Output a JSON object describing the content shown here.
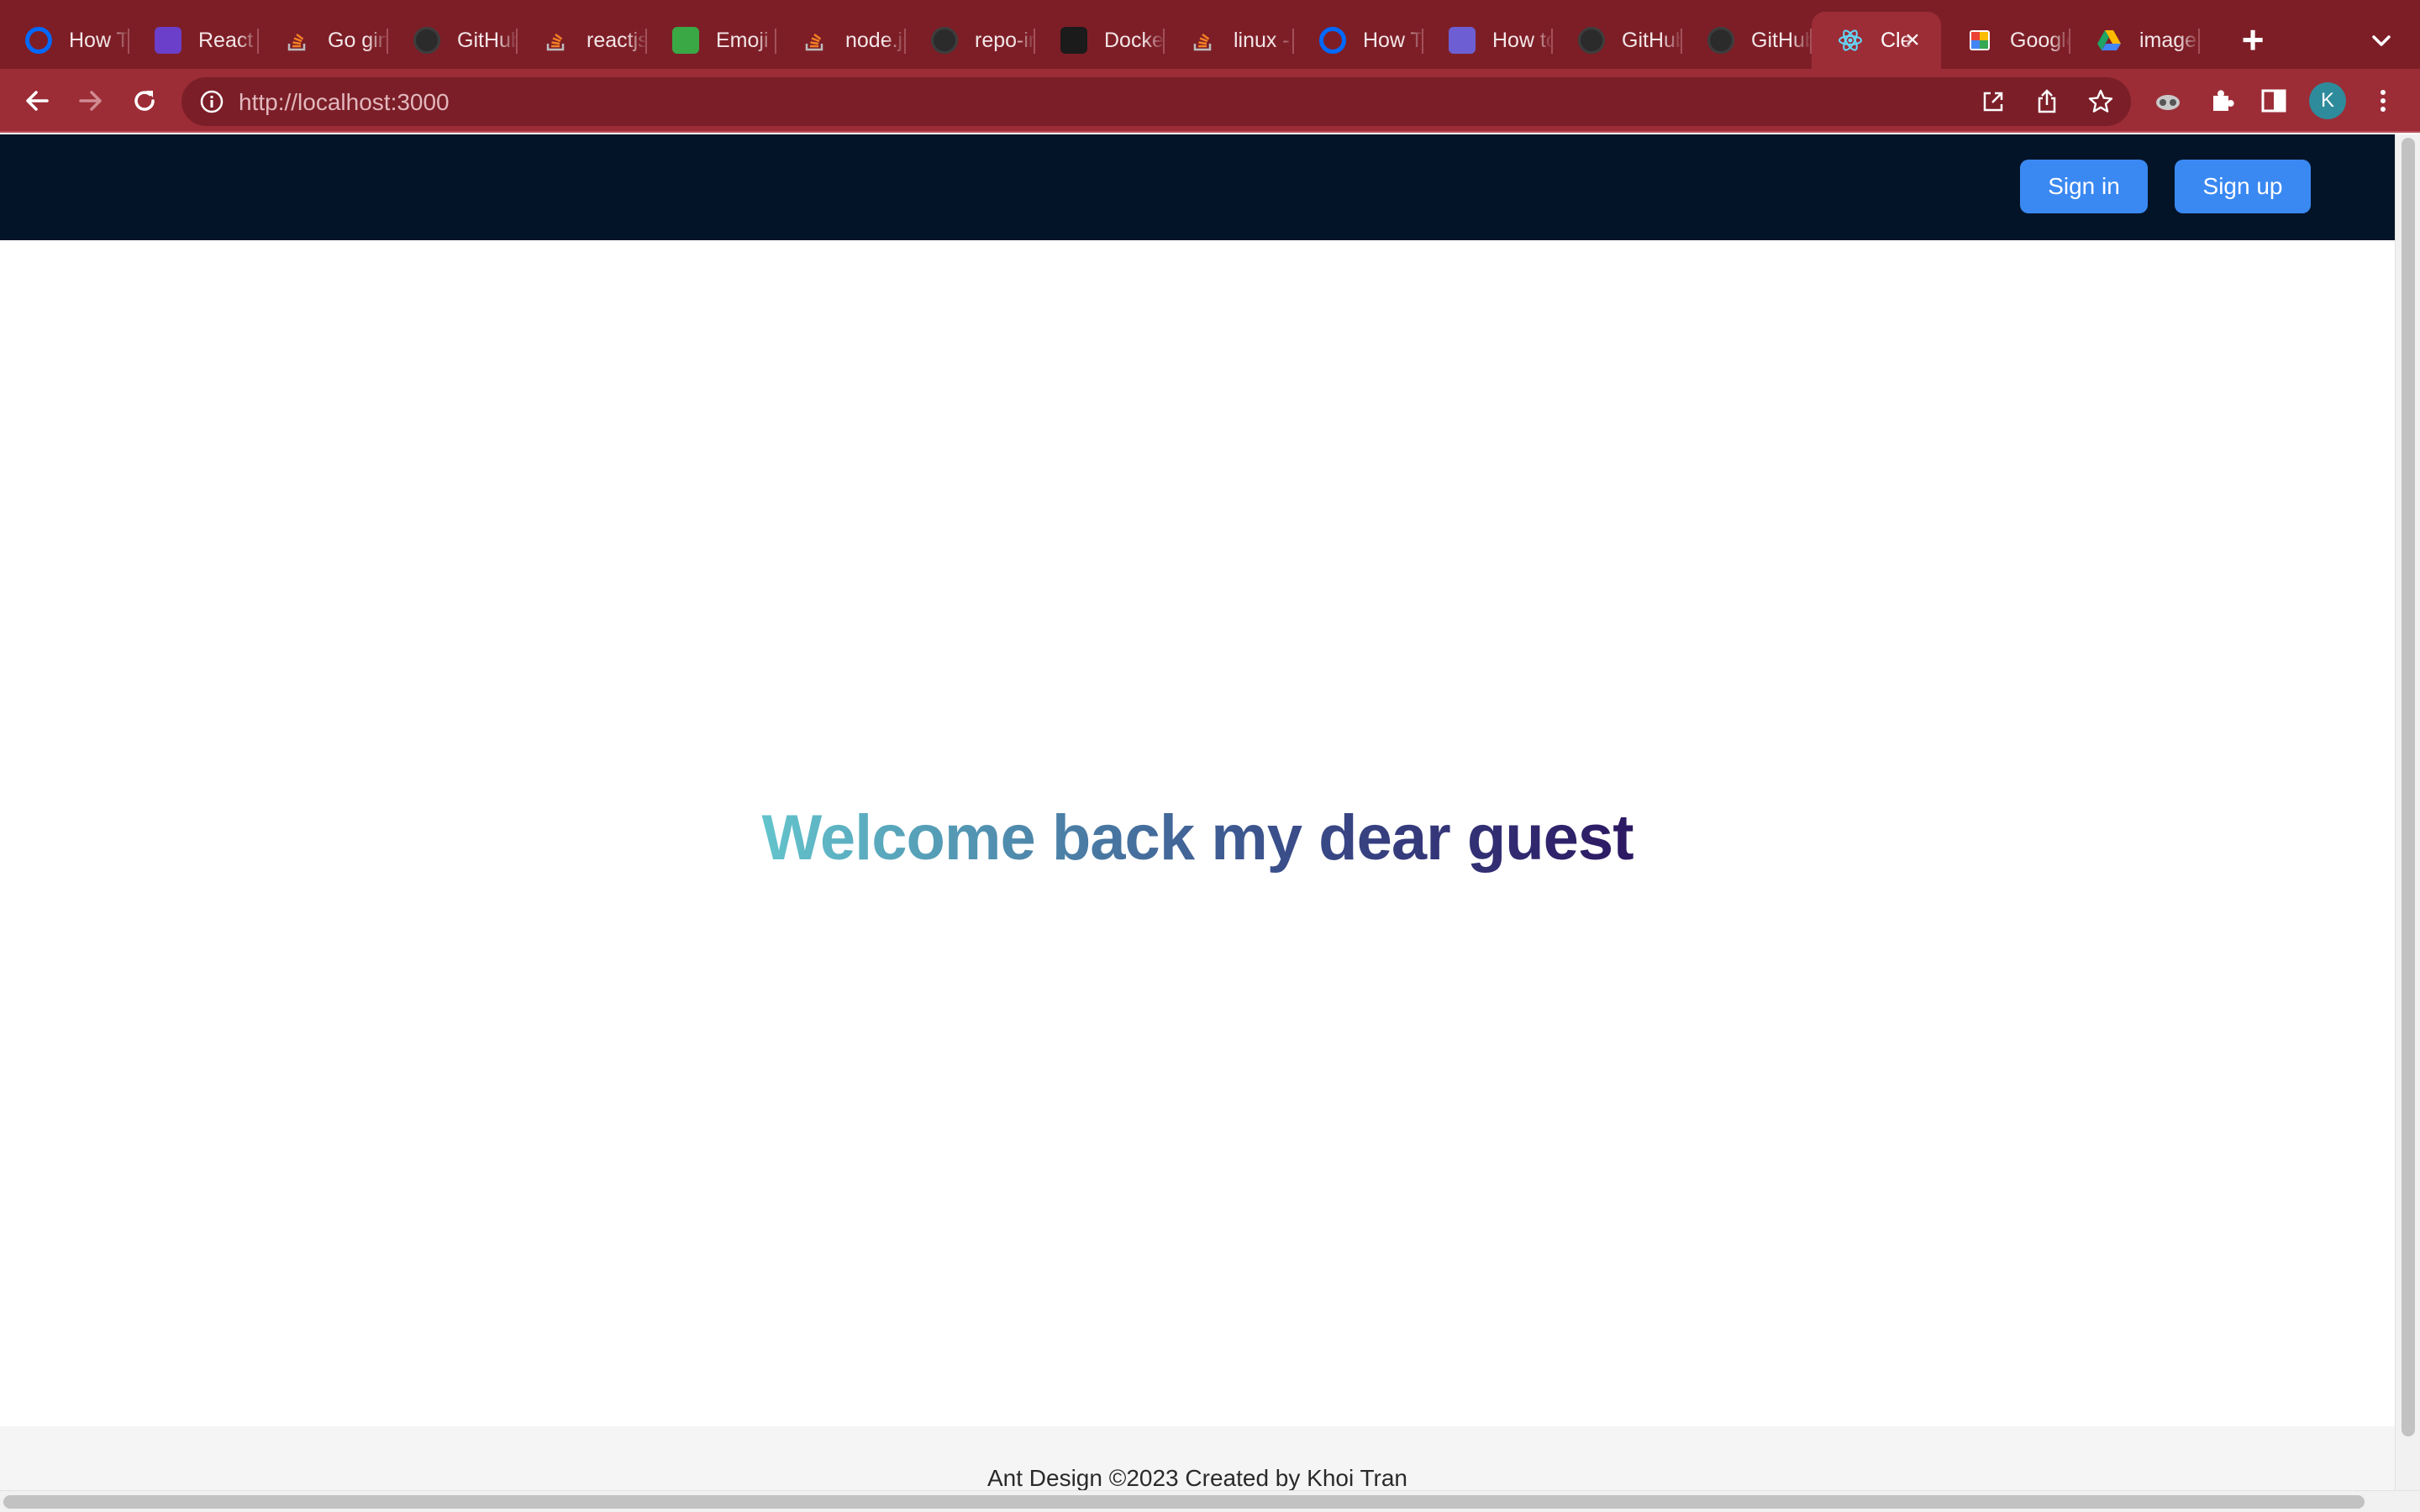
{
  "browser": {
    "tabs": [
      {
        "title": "How To",
        "favicon": "digitalocean-icon",
        "color": "#0069ff"
      },
      {
        "title": "React",
        "favicon": "rocket-app-icon",
        "color": "#6b3fc9"
      },
      {
        "title": "Go gin",
        "favicon": "stackoverflow-icon",
        "color": "#f48024"
      },
      {
        "title": "GitHub",
        "favicon": "github-icon",
        "color": "#24292f"
      },
      {
        "title": "reactjs",
        "favicon": "stackoverflow-icon",
        "color": "#f48024"
      },
      {
        "title": "Emoji",
        "favicon": "emoji-app-icon",
        "color": "#3aa845"
      },
      {
        "title": "node.js",
        "favicon": "stackoverflow-icon",
        "color": "#f48024"
      },
      {
        "title": "repo-in",
        "favicon": "github-icon",
        "color": "#24292f"
      },
      {
        "title": "Docker",
        "favicon": "docker-doc-icon",
        "color": "#1b1b1b"
      },
      {
        "title": "linux -",
        "favicon": "stackoverflow-icon",
        "color": "#f48024"
      },
      {
        "title": "How To",
        "favicon": "digitalocean-icon",
        "color": "#0069ff"
      },
      {
        "title": "How to",
        "favicon": "hexagon-app-icon",
        "color": "#6d5fd3"
      },
      {
        "title": "GitHub",
        "favicon": "github-icon",
        "color": "#24292f"
      },
      {
        "title": "GitHub",
        "favicon": "github-icon",
        "color": "#24292f"
      },
      {
        "title": "Cle",
        "favicon": "react-icon",
        "color": "#61dafb",
        "active": true
      },
      {
        "title": "Google",
        "favicon": "google-photos-icon",
        "color": "#ea4335"
      },
      {
        "title": "image",
        "favicon": "google-drive-icon",
        "color": "#1fa463"
      }
    ],
    "url_host": "http://localhost",
    "url_port": ":3000",
    "profile_initial": "K"
  },
  "header": {
    "sign_in_label": "Sign in",
    "sign_up_label": "Sign up"
  },
  "main": {
    "welcome_text": "Welcome back my dear guest"
  },
  "footer": {
    "text": "Ant Design ©2023 Created by Khoi Tran"
  },
  "colors": {
    "tabstrip": "#7d1e27",
    "toolbar": "#9c2d37",
    "app_header": "#041428",
    "button": "#3a89f2",
    "footer_bg": "#f5f5f5"
  }
}
